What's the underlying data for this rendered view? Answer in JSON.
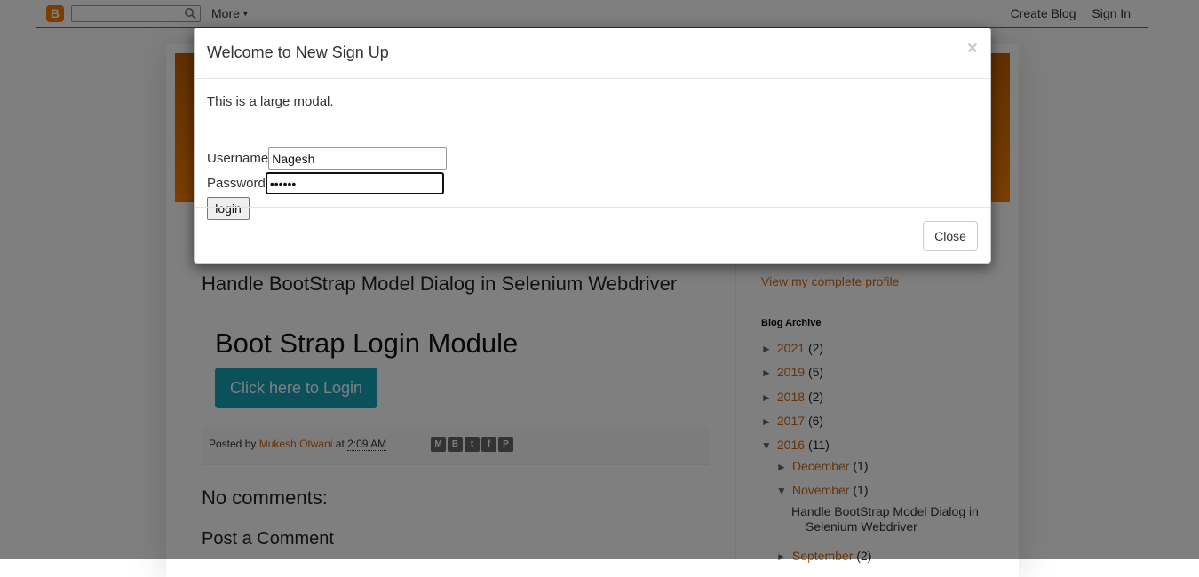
{
  "navbar": {
    "logo_icon": "blogger-logo-icon",
    "logo_glyph": "B",
    "search_placeholder": "",
    "more_label": "More",
    "create_blog_label": "Create Blog",
    "sign_in_label": "Sign In"
  },
  "post": {
    "title": "Handle BootStrap Model Dialog in Selenium Webdriver",
    "module_title": "Boot Strap Login Module",
    "cta_label": "Click here to Login",
    "footer": {
      "posted_by": "Posted by",
      "author": "Mukesh Otwani",
      "at": "at",
      "time": "2:09 AM",
      "share_icons": [
        "email-icon",
        "blogthis-icon",
        "twitter-icon",
        "facebook-icon",
        "pinterest-icon"
      ]
    },
    "comments_title": "No comments:",
    "post_comment_title": "Post a Comment"
  },
  "sidebar": {
    "profile_link": "View my complete profile",
    "archive_title": "Blog Archive",
    "archive": [
      {
        "toggle": "►",
        "label": "2021",
        "count": "(2)"
      },
      {
        "toggle": "►",
        "label": "2019",
        "count": "(5)"
      },
      {
        "toggle": "►",
        "label": "2018",
        "count": "(2)"
      },
      {
        "toggle": "►",
        "label": "2017",
        "count": "(6)"
      },
      {
        "toggle": "▼",
        "label": "2016",
        "count": "(11)"
      },
      {
        "toggle": "►",
        "label": "December",
        "count": "(1)"
      },
      {
        "toggle": "▼",
        "label": "November",
        "count": "(1)"
      },
      {
        "toggle": "►",
        "label": "September",
        "count": "(2)"
      }
    ],
    "archive_post": [
      "Handle BootStrap Model Dialog in",
      "Selenium Webdriver"
    ]
  },
  "modal": {
    "title": "Welcome to New Sign Up",
    "close_x": "×",
    "description": "This is a large modal.",
    "username_label": "Username",
    "username_value": "Nagesh",
    "password_label": "Password",
    "password_value": "123456",
    "login_label": "login",
    "close_label": "Close"
  },
  "colors": {
    "accent_link": "#cc6611",
    "cta_button": "#17a2b8",
    "header_band": "#f57d00",
    "backdrop": "rgba(0,0,0,0.5)"
  }
}
